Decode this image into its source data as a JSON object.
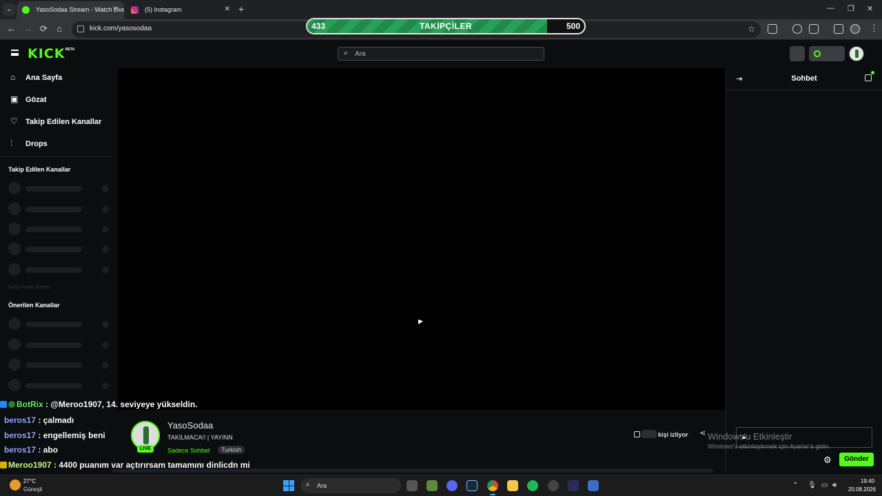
{
  "browser": {
    "tabs": [
      {
        "title": "YasoSodaa Stream - Watch Live",
        "active": true
      },
      {
        "title": "(5) Instagram",
        "active": false
      }
    ],
    "new_tab_glyph": "+",
    "url": "kick.com/yasosodaa"
  },
  "followers_goal": {
    "label": "TAKİPÇİLER",
    "current": "433",
    "target": "500",
    "progress_fraction": 0.866
  },
  "header": {
    "logo": "KICK",
    "logo_badge": "BETA",
    "search_placeholder": "Ara"
  },
  "sidebar": {
    "nav": [
      {
        "label": "Ana Sayfa",
        "icon": "home-icon"
      },
      {
        "label": "Gözat",
        "icon": "browse-icon"
      },
      {
        "label": "Takip Edilen Kanallar",
        "icon": "heart-icon"
      },
      {
        "label": "Drops",
        "icon": "drops-icon"
      }
    ],
    "followed_heading": "Takip Edilen Kanallar",
    "show_more": "Daha Fazla Göster",
    "recommended_heading": "Önerilen Kanallar"
  },
  "stream": {
    "streamer": "YasoSodaa",
    "title": "TAKILMACA!! | YAYINN",
    "category": "Sadece Sohbet",
    "language": "Turkish",
    "live_badge": "LIVE",
    "viewers_label": "kişi izliyor"
  },
  "chat": {
    "title": "Sohbet",
    "send_label": "Gönder"
  },
  "overlay_chat": [
    {
      "user": "BotRix",
      "message": ": @Meroo1907, 14. seviyeye yükseldin.",
      "style": "bot"
    },
    {
      "user": "beros17",
      "message": ": çalmadı",
      "style": "user"
    },
    {
      "user": "beros17",
      "message": ": engellemiş beni",
      "style": "user"
    },
    {
      "user": "beros17",
      "message": ": abo",
      "style": "user"
    },
    {
      "user": "Meroo1907",
      "message": ": 4400 puanım var açtırırsam tamamını dinlicdn mi",
      "style": "mero"
    }
  ],
  "windows_watermark": {
    "title": "Windows'u Etkinleştir",
    "subtitle": "Windows'u etkinleştirmek için Ayarlar'a gidin."
  },
  "taskbar": {
    "weather_temp": "27°C",
    "weather_desc": "Güneşli",
    "search_placeholder": "Ara",
    "time": "19:40",
    "date": "20.08.2026"
  },
  "colors": {
    "kick_green": "#53fc18",
    "background": "#0b0e0f",
    "goal_bar": "#27a157"
  }
}
